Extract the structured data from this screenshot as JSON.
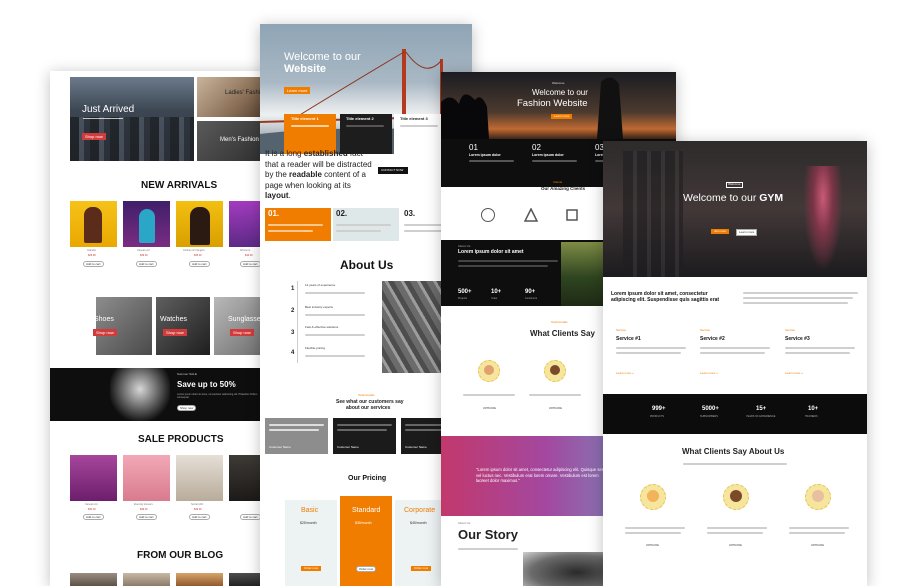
{
  "sheet1": {
    "hero": {
      "title": "Just Arrived",
      "cta": "Shop now",
      "side_top": "Ladies' Fashion",
      "side_bottom": "Men's Fashion"
    },
    "new_arrivals": {
      "heading": "NEW ARRIVALS",
      "products": [
        {
          "name": "Grandis",
          "price_old": "$39.99",
          "price": "$29.99",
          "btn": "Add to cart"
        },
        {
          "name": "Casual unit",
          "price_old": "$45.00",
          "price": "$39.00",
          "btn": "Add to cart"
        },
        {
          "name": "Clothes on hangers",
          "price_old": "",
          "price": "$35.00",
          "btn": "Add to cart"
        },
        {
          "name": "Women's",
          "price_old": "",
          "price": "$44.00",
          "btn": "Add to cart"
        }
      ]
    },
    "categories": [
      {
        "label": "Shoes",
        "btn": "Shop now"
      },
      {
        "label": "Watches",
        "btn": "Shop now"
      },
      {
        "label": "Sunglasses",
        "btn": "Shop now"
      }
    ],
    "promo": {
      "kicker": "Summer SALE",
      "title": "Save up to 50%",
      "text": "Lorem ipsum dolor sit amet, consectetur adipiscing elit. Phasellus finibus consequat.",
      "btn": "Shop now"
    },
    "sale": {
      "heading": "SALE PRODUCTS",
      "products": [
        {
          "name": "Casual unit",
          "price_old": "$45.00",
          "price": "$30.00",
          "btn": "Add to cart"
        },
        {
          "name": "Evening trousers",
          "price_old": "$65.00",
          "price": "$49.00",
          "btn": "Add to cart"
        },
        {
          "name": "Social shirt",
          "price_old": "$59.00",
          "price": "$39.00",
          "btn": "Add to cart"
        },
        {
          "name": "",
          "price_old": "",
          "price": "",
          "btn": "Add to cart"
        }
      ]
    },
    "blog": {
      "heading": "FROM OUR BLOG"
    }
  },
  "sheet2": {
    "hero": {
      "line1": "Welcome to our",
      "line2": "Website",
      "btn": "Learn more"
    },
    "features": [
      "Title element 1",
      "Title element 2",
      "Title element 3"
    ],
    "intro": {
      "p1": "It is a long ",
      "b1": "established",
      "p2": " fact that a reader will be distracted by the ",
      "b2": "readable",
      "p3": " content of a page when looking at its ",
      "b3": "layout",
      "p4": ".",
      "btn": "CONTACT NOW"
    },
    "steps": [
      {
        "num": "01."
      },
      {
        "num": "02."
      },
      {
        "num": "03."
      }
    ],
    "about": {
      "heading": "About Us",
      "items": [
        {
          "num": "1",
          "title": "12 years of experience"
        },
        {
          "num": "2",
          "title": "Best industry experts"
        },
        {
          "num": "3",
          "title": "Fast & effective solutions"
        },
        {
          "num": "4",
          "title": "Flexible pricing"
        }
      ]
    },
    "testimonials": {
      "kicker": "Testimonials",
      "heading_l1": "See what our customers say",
      "heading_l2": "about our services",
      "author": "Customer Name"
    },
    "pricing": {
      "heading": "Our Pricing",
      "plans": [
        {
          "name": "Basic",
          "price": "$25/month",
          "btn": "Order now"
        },
        {
          "name": "Standard",
          "price": "$35/month",
          "btn": "Order now"
        },
        {
          "name": "Corporate",
          "price": "$45/month",
          "btn": "Order now"
        }
      ]
    }
  },
  "sheet3": {
    "hero": {
      "kicker": "Welcome",
      "line1": "Welcome to our",
      "line2": "Fashion Website",
      "btn": "Learn more"
    },
    "columns": [
      {
        "num": "01",
        "title": "Lorem ipsum dolor"
      },
      {
        "num": "02",
        "title": "Lorem ipsum dolor"
      },
      {
        "num": "03",
        "title": "Lorem ipsum"
      }
    ],
    "clients": {
      "kicker": "Clients",
      "heading": "Our Amazing Clients"
    },
    "about": {
      "kicker": "About Us",
      "title": "Lorem ipsum dolor sit amet"
    },
    "stats": [
      {
        "value": "500+",
        "label": "Projects"
      },
      {
        "value": "10+",
        "label": "Years"
      },
      {
        "value": "90+",
        "label": "Customers"
      }
    ],
    "clients_say": {
      "kicker": "Testimonials",
      "heading": "What Clients Say",
      "names": [
        "JOHN DOE",
        "JOHN DOE"
      ]
    },
    "quote": "\"Lorem ipsum dolor sit amet, consectetur adipiscing elit. Quisque sem vel luctus nec. Vestibulum erat lorem ornare. Vestibulum est lorem laoreet dolor maximus.\"",
    "story": {
      "kicker": "About Us",
      "heading": "Our Story"
    }
  },
  "sheet4": {
    "hero": {
      "kicker": "Welcome",
      "line1": "Welcome to our ",
      "line2": "GYM",
      "btn1": "Join now",
      "btn2": "Learn more"
    },
    "intro": {
      "title": "Lorem ipsum dolor sit amet, consectetur adipiscing elit. Suspendisse quis sagittis erat"
    },
    "services": [
      {
        "kicker": "Service",
        "title": "Service #1",
        "link": "Learn more »"
      },
      {
        "kicker": "Service",
        "title": "Service #2",
        "link": "Learn more »"
      },
      {
        "kicker": "Service",
        "title": "Service #3",
        "link": "Learn more »"
      }
    ],
    "stats": [
      {
        "value": "999+",
        "label": "PRODUCTS"
      },
      {
        "value": "5000+",
        "label": "SUBSCRIBERS"
      },
      {
        "value": "15+",
        "label": "YEARS OF EXPERIENCE"
      },
      {
        "value": "10+",
        "label": "TRAINERS"
      }
    ],
    "clients": {
      "heading": "What Clients Say About Us",
      "names": [
        "JOHN DOE",
        "JOHN DOE",
        "JOHN DOE"
      ]
    }
  },
  "colors": {
    "accent_red": "#d13b3b",
    "accent_orange": "#f07d00",
    "dark": "#111111"
  }
}
